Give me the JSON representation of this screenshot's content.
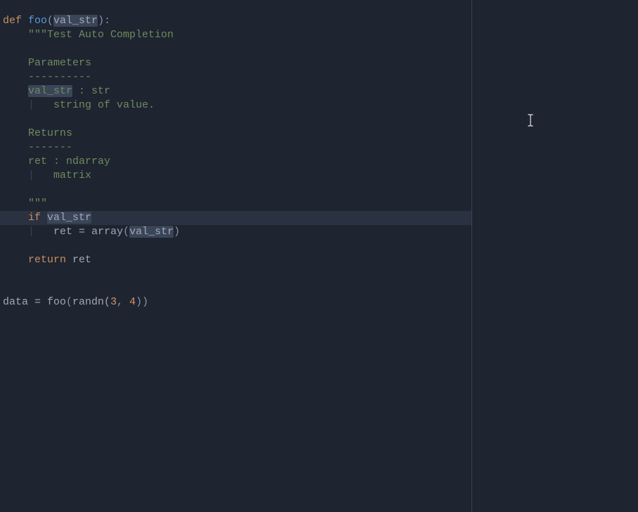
{
  "code": {
    "l1": {
      "def": "def ",
      "fn": "foo",
      "open": "(",
      "param": "val_str",
      "close": "):"
    },
    "l2": {
      "indent": "    ",
      "doc_open": "\"\"\"",
      "title": "Test Auto Completion"
    },
    "l3": "",
    "l4": {
      "indent": "    ",
      "txt": "Parameters"
    },
    "l5": {
      "indent": "    ",
      "txt": "----------"
    },
    "l6": {
      "indent": "    ",
      "param": "val_str",
      "rest": " : str"
    },
    "l7": {
      "indent": "    ",
      "guide": "|",
      "space": "   ",
      "txt": "string of value."
    },
    "l8": "",
    "l9": {
      "indent": "    ",
      "txt": "Returns"
    },
    "l10": {
      "indent": "    ",
      "txt": "-------"
    },
    "l11": {
      "indent": "    ",
      "txt": "ret : ndarray"
    },
    "l12": {
      "indent": "    ",
      "guide": "|",
      "space": "   ",
      "txt": "matrix"
    },
    "l13": "",
    "l14": {
      "indent": "    ",
      "doc_close": "\"\"\""
    },
    "l15": {
      "indent": "    ",
      "if": "if ",
      "var": "val_str"
    },
    "l16": {
      "indent": "    ",
      "guide": "|",
      "space": "   ",
      "lhs": "ret = ",
      "call": "array",
      "open": "(",
      "arg": "val_str",
      "close": ")"
    },
    "l17": "",
    "l18": {
      "indent": "    ",
      "ret": "return ",
      "var": "ret"
    },
    "l19": "",
    "l20": "",
    "l21": {
      "lhs": "data = ",
      "fn": "foo",
      "open": "(",
      "inner": "randn(",
      "n1": "3",
      "comma": ", ",
      "n2": "4",
      "close": "))"
    }
  }
}
